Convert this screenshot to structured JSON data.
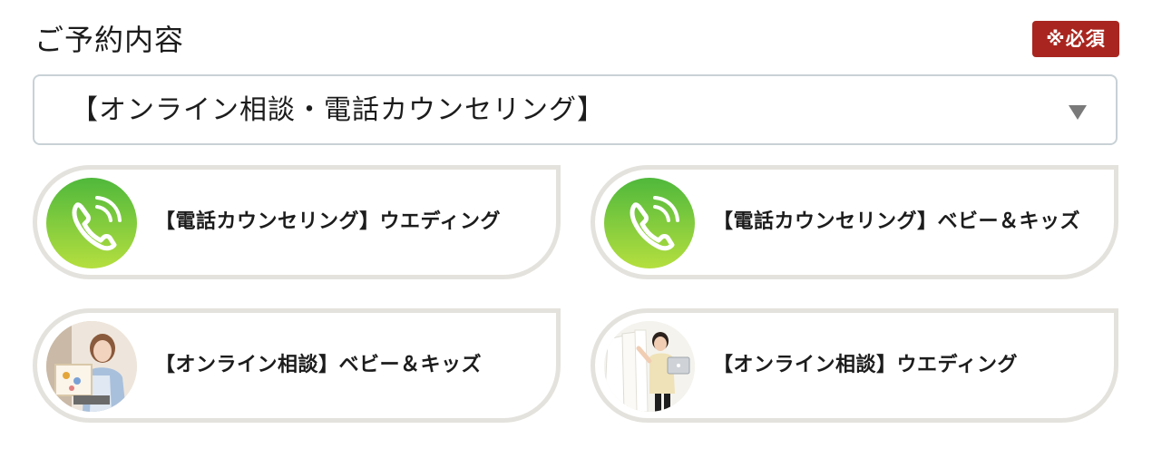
{
  "section": {
    "title": "ご予約内容",
    "required_badge": "※必須"
  },
  "select": {
    "value": "【オンライン相談・電話カウンセリング】"
  },
  "options": [
    {
      "label": "【電話カウンセリング】ウエディング",
      "icon": "phone-icon"
    },
    {
      "label": "【電話カウンセリング】ベビー＆キッズ",
      "icon": "phone-icon"
    },
    {
      "label": "【オンライン相談】ベビー＆キッズ",
      "icon": "photo-woman-laptop"
    },
    {
      "label": "【オンライン相談】ウエディング",
      "icon": "photo-woman-dresses"
    }
  ],
  "colors": {
    "required_badge": "#a8261f",
    "phone_gradient_top": "#4fb83c",
    "phone_gradient_bottom": "#b5df3f",
    "card_border": "#e4e2dc",
    "select_border": "#c8d1d6"
  }
}
